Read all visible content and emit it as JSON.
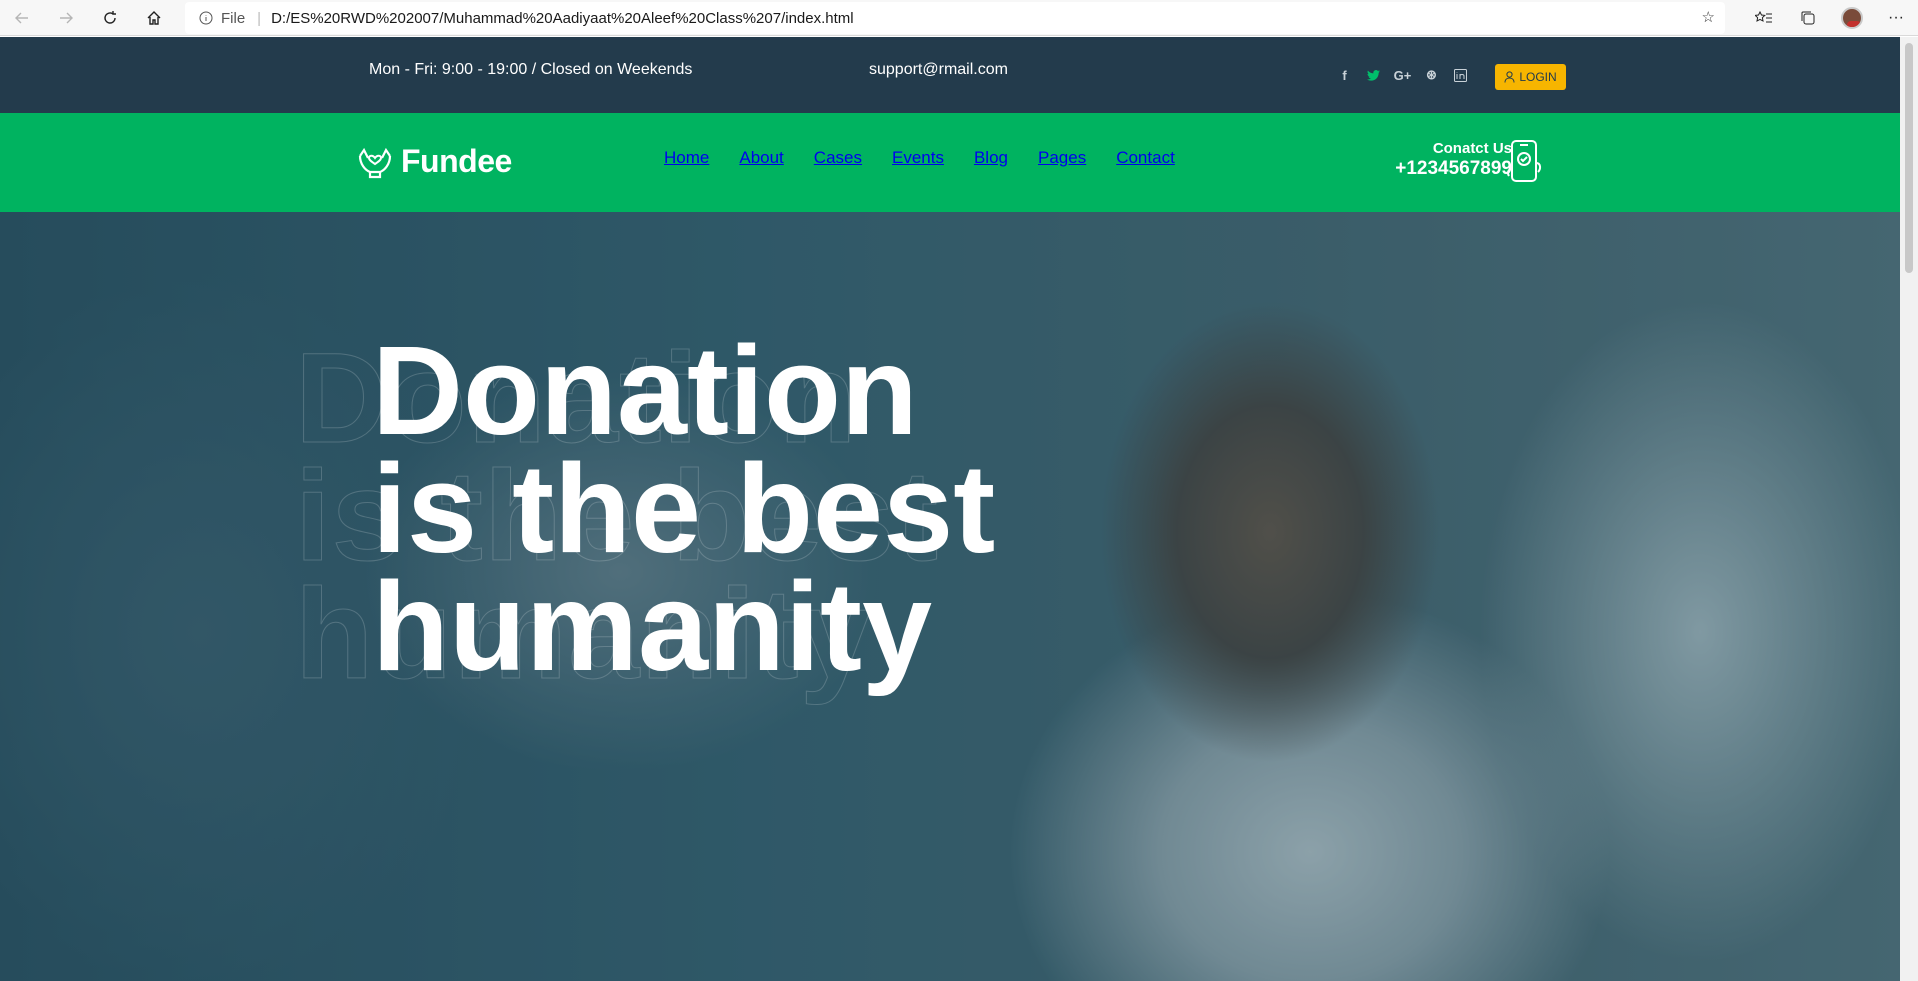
{
  "browser": {
    "file_label": "File",
    "url": "D:/ES%20RWD%202007/Muhammad%20Aadiyaat%20Aleef%20Class%207/index.html"
  },
  "topbar": {
    "hours": "Mon - Fri: 9:00 - 19:00 / Closed on Weekends",
    "email": "support@rmail.com",
    "social": [
      {
        "icon": "facebook-icon",
        "glyph": "f"
      },
      {
        "icon": "twitter-icon",
        "glyph": "t"
      },
      {
        "icon": "google-plus-icon",
        "glyph": "G+"
      },
      {
        "icon": "dribbble-icon",
        "glyph": "⊛"
      },
      {
        "icon": "linkedin-icon",
        "glyph": "in"
      }
    ],
    "login_label": "LOGIN"
  },
  "navbar": {
    "brand": "Fundee",
    "menu": [
      "Home",
      "About",
      "Cases",
      "Events",
      "Blog",
      "Pages",
      "Contact"
    ],
    "contact_label": "Conatct Us",
    "contact_number": "+1234567899"
  },
  "hero": {
    "line1": "Donation",
    "line2": "is the best",
    "line3": "humanity"
  },
  "colors": {
    "topbar_bg": "#233b4c",
    "navbar_bg": "#00b360",
    "login_bg": "#f7b500"
  }
}
